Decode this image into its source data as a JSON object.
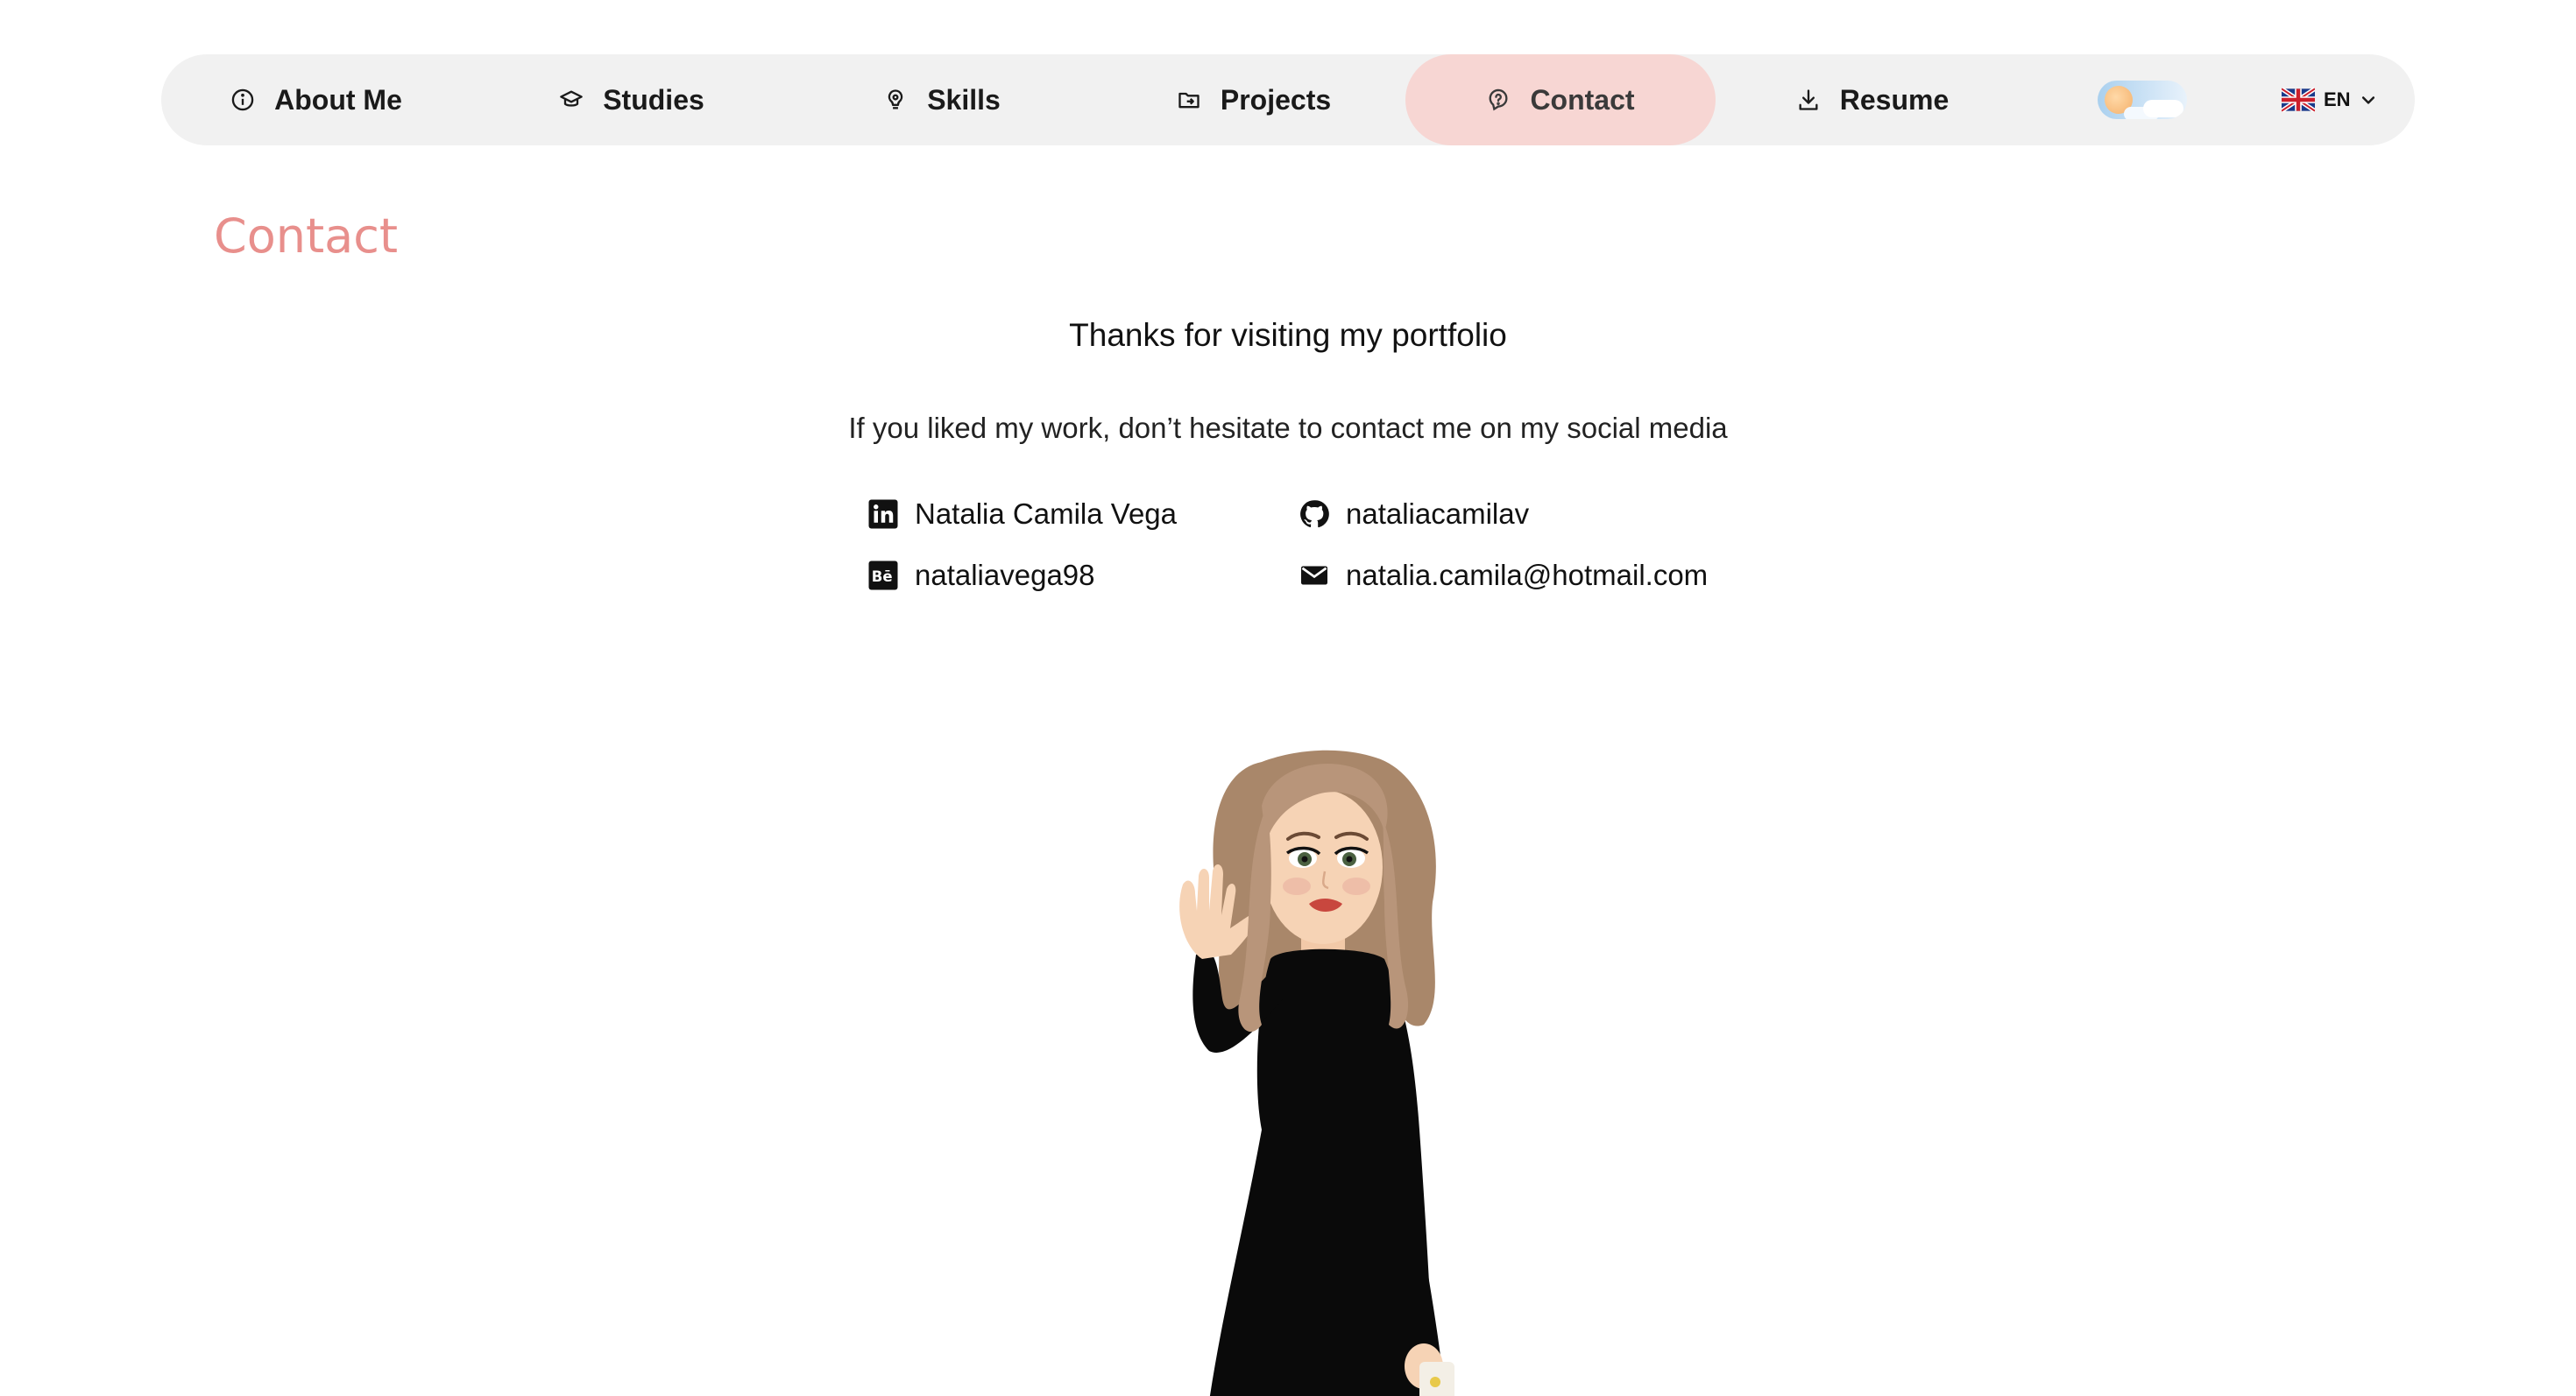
{
  "nav": {
    "items": [
      {
        "label": "About Me",
        "icon": "info-icon"
      },
      {
        "label": "Studies",
        "icon": "graduation-cap-icon"
      },
      {
        "label": "Skills",
        "icon": "lightbulb-icon"
      },
      {
        "label": "Projects",
        "icon": "folder-icon"
      },
      {
        "label": "Contact",
        "icon": "question-icon"
      },
      {
        "label": "Resume",
        "icon": "download-icon"
      }
    ],
    "active": "Contact",
    "theme_toggle": "light",
    "language": {
      "code": "EN",
      "flag": "uk-flag-icon"
    }
  },
  "contact": {
    "title": "Contact",
    "thanks": "Thanks for visiting my portfolio",
    "subtitle": "If you liked my work, don’t hesitate to contact me on my social media",
    "links": {
      "linkedin": {
        "label": "Natalia Camila Vega",
        "icon": "linkedin-icon"
      },
      "github": {
        "label": "nataliacamilav",
        "icon": "github-icon"
      },
      "behance": {
        "label": "nataliavega98",
        "icon": "behance-icon"
      },
      "email": {
        "label": "natalia.camila@hotmail.com",
        "icon": "email-icon"
      }
    }
  },
  "colors": {
    "accent": "#e88f8c",
    "active_tab_bg": "#f7d6d3",
    "nav_bg": "#f1f1f1"
  }
}
